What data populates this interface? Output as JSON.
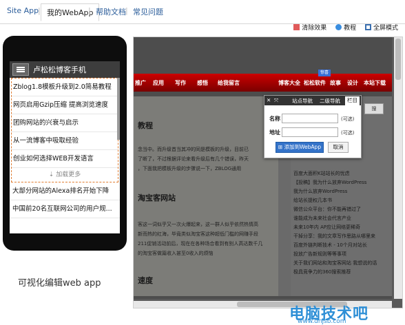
{
  "tabs": [
    {
      "label": "Site App"
    },
    {
      "label": "我的WebApp"
    },
    {
      "label": "帮助文档"
    },
    {
      "label": "常见问题"
    }
  ],
  "toolbar": {
    "clear_label": "清除效果",
    "tutorial_label": "教程",
    "fullscreen_label": "全屏模式"
  },
  "phone": {
    "title": "卢松松博客手机",
    "items": [
      "Zblog1.8模板升级到2.0简易教程",
      "网页启用Gzip压缩 提高浏览速度",
      "团购网站的兴衰与启示",
      "从一流博客中吸取经验",
      "创业如何选择WEB开发语言"
    ],
    "load_more": "加载更多",
    "items_below": [
      "大部分网站的Alexa排名开始下降",
      "中国前20名互联网公司的用户规..."
    ]
  },
  "caption": "可视化编辑web app",
  "preview": {
    "nav_items": [
      "推广",
      "应用",
      "写作",
      "感悟",
      "给我留言",
      "博客大全",
      "松松软件",
      "故事",
      "设计",
      "本站下载"
    ],
    "hot_badge": "惊喜",
    "search_btn": "搜",
    "content_titles": [
      "教程",
      "淘宝客网站",
      "速度"
    ],
    "sidebar_lines": [
      "百度大面积K站站长的忧虑",
      "【投稿】我为什么放弃WordPress",
      "我为什么放弃WordPress",
      "给站长提权几本书",
      "微信公众平台：你不能再错过了",
      "谁能成为未来社会代言产业",
      "未来10年内 AP应让网络更稀奇",
      "干掉分享：我的文章写作思路从哪里来",
      "百度外链判断技术 - 10个月对站长",
      "投放广告新规则等等事项",
      "关于我们网站和淘宝客网站 我想说的话",
      "极具竞争力的360搜索推荐"
    ]
  },
  "popup": {
    "tabs": [
      "站点导航",
      "二级导航",
      "栏目"
    ],
    "name_label": "名称",
    "address_label": "地址",
    "optional_hint": "(可选)",
    "add_button": "添加到WebApp",
    "cancel_button": "取消"
  },
  "watermark": {
    "text": "电脑技术吧",
    "url": "www.dnjsb.com"
  }
}
